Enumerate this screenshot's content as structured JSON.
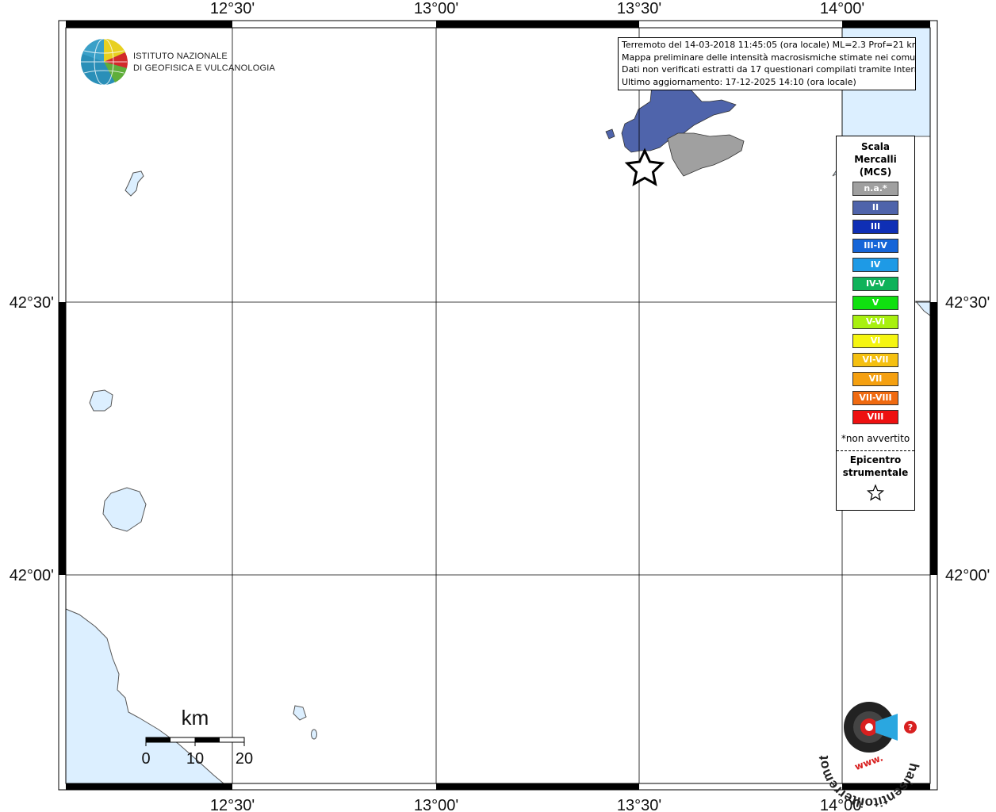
{
  "info_box": {
    "line1": "Terremoto del 14-03-2018 11:45:05 (ora locale) ML=2.3 Prof=21 km",
    "line2": "Mappa preliminare delle intensità macrosismiche stimate nei comuni",
    "line3": "Dati non verificati estratti da 17 questionari compilati tramite Internet.",
    "line4": "Ultimo aggiornamento: 17-12-2025 14:10 (ora locale)"
  },
  "logo_ingv": {
    "line1": "ISTITUTO NAZIONALE",
    "line2": "DI GEOFISICA E VULCANOLOGIA"
  },
  "axes": {
    "top": [
      "12°30'",
      "13°00'",
      "13°30'",
      "14°00'"
    ],
    "bottom": [
      "12°30'",
      "13°00'",
      "13°30'",
      "14°00'"
    ],
    "left": [
      "42°30'",
      "42°00'"
    ],
    "right": [
      "42°30'",
      "42°00'"
    ]
  },
  "legend": {
    "title": "Scala Mercalli (MCS)",
    "title_lines": [
      "Scala",
      "Mercalli",
      "(MCS)"
    ],
    "items": [
      {
        "label": "n.a.*",
        "color": "#a0a0a0"
      },
      {
        "label": "II",
        "color": "#4f64ab"
      },
      {
        "label": "III",
        "color": "#0f2fb5"
      },
      {
        "label": "III-IV",
        "color": "#1565d8"
      },
      {
        "label": "IV",
        "color": "#1e9ae6"
      },
      {
        "label": "IV-V",
        "color": "#0fb25a"
      },
      {
        "label": "V",
        "color": "#10e010"
      },
      {
        "label": "V-VI",
        "color": "#a8f010"
      },
      {
        "label": "VI",
        "color": "#f5f510"
      },
      {
        "label": "VI-VII",
        "color": "#f5c010"
      },
      {
        "label": "VII",
        "color": "#f5a010"
      },
      {
        "label": "VII-VIII",
        "color": "#f06a10"
      },
      {
        "label": "VIII",
        "color": "#ee1010"
      }
    ],
    "note": "*non avvertito",
    "epicenter_lines": [
      "Epicentro",
      "strumentale"
    ],
    "epicenter_icon": "star-outline-icon"
  },
  "scalebar": {
    "unit": "km",
    "labels": [
      "0",
      "10",
      "20"
    ]
  },
  "haisentito": {
    "text": "haisentitoilterremoto.it",
    "url_text": "www."
  },
  "colors": {
    "water": "#dcefff",
    "intensity_II": "#4f64ab",
    "not_felt": "#a0a0a0"
  }
}
